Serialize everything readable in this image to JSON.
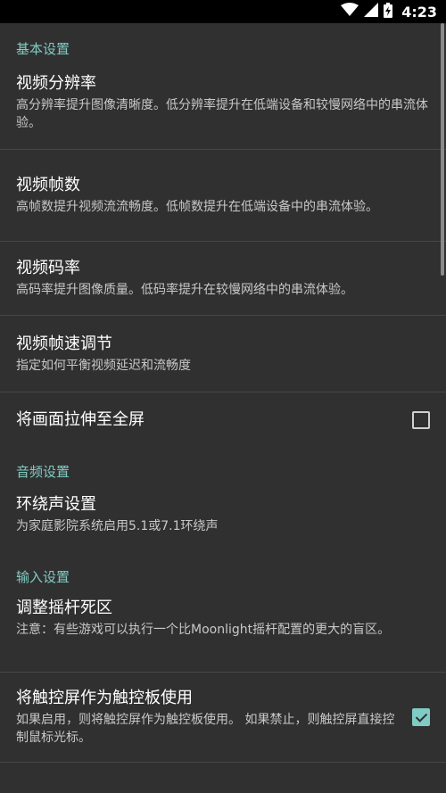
{
  "status_bar": {
    "time": "4:23",
    "icons": [
      "wifi-icon",
      "signal-icon",
      "battery-charging-icon"
    ]
  },
  "sections": {
    "basic": {
      "header": "基本设置",
      "items": [
        {
          "title": "视频分辨率",
          "summary": "高分辨率提升图像清晰度。低分辨率提升在低端设备和较慢网络中的串流体验。"
        },
        {
          "title": "视频帧数",
          "summary": "高帧数提升视频流流畅度。低帧数提升在低端设备中的串流体验。"
        },
        {
          "title": "视频码率",
          "summary": "高码率提升图像质量。低码率提升在较慢网络中的串流体验。"
        },
        {
          "title": "视频帧速调节",
          "summary": "指定如何平衡视频延迟和流畅度"
        },
        {
          "title": "将画面拉伸至全屏",
          "checked": false
        }
      ]
    },
    "audio": {
      "header": "音频设置",
      "items": [
        {
          "title": "环绕声设置",
          "summary": "为家庭影院系统启用5.1或7.1环绕声"
        }
      ]
    },
    "input": {
      "header": "输入设置",
      "items": [
        {
          "title": "调整摇杆死区",
          "summary": "注意：有些游戏可以执行一个比Moonlight摇杆配置的更大的盲区。"
        },
        {
          "title": "将触控屏作为触控板使用",
          "summary": "如果启用，则将触控屏作为触控板使用。 如果禁止，则触控屏直接控制鼠标光标。",
          "checked": true
        }
      ]
    }
  },
  "colors": {
    "background": "#303030",
    "accent": "#80cbc4",
    "status_bar": "#000000",
    "divider": "#474747"
  }
}
